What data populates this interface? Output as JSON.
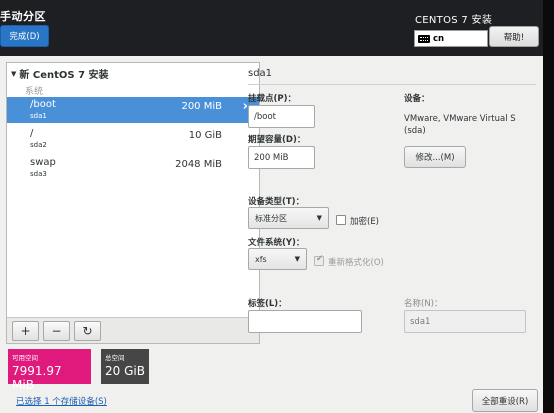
{
  "header": {
    "page_title": "手动分区",
    "done_label": "完成(D)",
    "product_title": "CENTOS 7 安装",
    "keyboard_layout": "cn",
    "help_label": "帮助!"
  },
  "sidebar": {
    "install_title": "新 CentOS 7 安装",
    "group_label": "系统",
    "partitions": [
      {
        "mount": "/boot",
        "device": "sda1",
        "size": "200 MiB",
        "selected": true
      },
      {
        "mount": "/",
        "device": "sda2",
        "size": "10 GiB",
        "selected": false
      },
      {
        "mount": "swap",
        "device": "sda3",
        "size": "2048 MiB",
        "selected": false
      }
    ],
    "toolbar": {
      "add": "+",
      "remove": "−",
      "refresh": "↻"
    },
    "available": {
      "label": "可用空间",
      "value": "7991.97 MiB"
    },
    "total": {
      "label": "总空间",
      "value": "20 GiB"
    },
    "storage_link": "已选择 1 个存储设备(S)"
  },
  "detail": {
    "title": "sda1",
    "mount_label": "挂载点(P)：",
    "mount_value": "/boot",
    "capacity_label": "期望容量(D)：",
    "capacity_value": "200 MiB",
    "device_label": "设备：",
    "device_desc": "VMware, VMware Virtual S (sda)",
    "modify_label": "修改...(M)",
    "device_type_label": "设备类型(T)：",
    "device_type_value": "标准分区",
    "encrypt_label": "加密(E)",
    "fs_label": "文件系统(Y)：",
    "fs_value": "xfs",
    "reformat_label": "重新格式化(O)",
    "tag_label": "标签(L)：",
    "tag_value": "",
    "name_label": "名称(N)：",
    "name_value": "sda1",
    "reset_label": "全部重设(R)"
  },
  "colors": {
    "selection": "#4a90d9",
    "available_bg": "#e0197d",
    "total_bg": "#464646",
    "done_button": "#2a76c6",
    "link": "#1a5fb4"
  }
}
